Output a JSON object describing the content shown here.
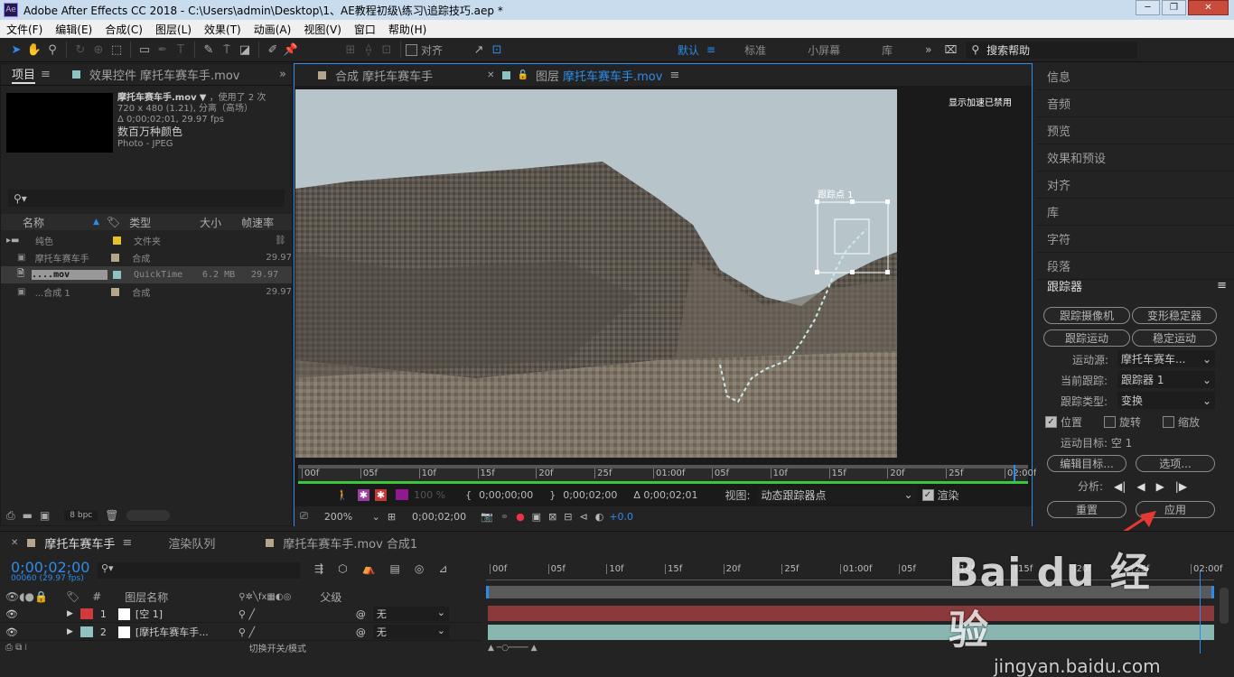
{
  "window": {
    "title": "Adobe After Effects CC 2018 - C:\\Users\\admin\\Desktop\\1、AE教程初级\\练习\\追踪技巧.aep *",
    "app_icon": "Ae"
  },
  "menu": [
    "文件(F)",
    "编辑(E)",
    "合成(C)",
    "图层(L)",
    "效果(T)",
    "动画(A)",
    "视图(V)",
    "窗口",
    "帮助(H)"
  ],
  "toolbar": {
    "align_label": "对齐",
    "workspaces": [
      "默认",
      "标准",
      "小屏幕",
      "库"
    ],
    "search_placeholder": "搜索帮助"
  },
  "project": {
    "tab_project": "项目",
    "tab_effects": "效果控件 摩托车赛车手.mov",
    "info_name": "摩托车赛车手.mov",
    "info_used": "，使用了 2 次",
    "info_dims": "720 x 480 (1.21), 分离（高场）",
    "info_duration": "Δ 0;00;02;01, 29.97 fps",
    "info_colors": "数百万种颜色",
    "info_codec": "Photo - JPEG",
    "columns": {
      "name": "名称",
      "type": "类型",
      "size": "大小",
      "fps": "帧速率"
    },
    "items": [
      {
        "name": "纯色",
        "type": "文件夹",
        "size": "",
        "fps": "",
        "color": "#e6c229"
      },
      {
        "name": "摩托车赛车手",
        "type": "合成",
        "size": "",
        "fps": "29.97",
        "color": "#b5a58a"
      },
      {
        "name": "....mov",
        "type": "QuickTime",
        "size": "6.2 MB",
        "fps": "29.97",
        "color": "#8fc3c3"
      },
      {
        "name": "...合成 1",
        "type": "合成",
        "size": "",
        "fps": "29.97",
        "color": "#b5a58a"
      }
    ],
    "bpc": "8 bpc"
  },
  "viewer": {
    "tab_comp": "合成 摩托车赛车手",
    "tab_layer_prefix": "图层",
    "tab_layer_name": "摩托车赛车手.mov",
    "gpu_notice": "显示加速已禁用",
    "track_point_label": "跟踪点 1",
    "ruler": [
      "00f",
      "05f",
      "10f",
      "15f",
      "20f",
      "25f",
      "01:00f",
      "05f",
      "10f",
      "15f",
      "20f",
      "25f",
      "02:00f"
    ],
    "opacity": "100 %",
    "in_time": "0;00;00;00",
    "out_time": "0;00;02;00",
    "duration": "Δ 0;00;02;01",
    "view_label": "视图:",
    "view_value": "动态跟踪器点",
    "render_label": "渲染",
    "zoom": "200%",
    "current_time": "0;00;02;00",
    "exposure": "+0.0"
  },
  "right_panels": [
    "信息",
    "音频",
    "预览",
    "效果和预设",
    "对齐",
    "库",
    "字符",
    "段落"
  ],
  "tracker": {
    "title": "跟踪器",
    "btn_track_camera": "跟踪摄像机",
    "btn_warp_stabilizer": "变形稳定器",
    "btn_track_motion": "跟踪运动",
    "btn_stabilize_motion": "稳定运动",
    "motion_source_label": "运动源:",
    "motion_source_value": "摩托车赛车...",
    "current_track_label": "当前跟踪:",
    "current_track_value": "跟踪器 1",
    "track_type_label": "跟踪类型:",
    "track_type_value": "变换",
    "position_label": "位置",
    "rotation_label": "旋转",
    "scale_label": "缩放",
    "motion_target": "运动目标: 空 1",
    "btn_edit_target": "编辑目标...",
    "btn_options": "选项...",
    "analyze_label": "分析:",
    "btn_reset": "重置",
    "btn_apply": "应用"
  },
  "timeline": {
    "tab_active": "摩托车赛车手",
    "tab_render": "渲染队列",
    "tab_other": "摩托车赛车手.mov 合成1",
    "timecode": "0;00;02;00",
    "frame_info": "00060 (29.97 fps)",
    "col_layer_name": "图层名称",
    "col_parent": "父级",
    "col_num": "#",
    "ruler": [
      "00f",
      "05f",
      "10f",
      "15f",
      "20f",
      "25f",
      "01:00f",
      "05f",
      "10f",
      "15f",
      "20f",
      "25f",
      "02:00f"
    ],
    "layers": [
      {
        "num": "1",
        "name": "[空 1]",
        "parent": "无",
        "label_color": "#d03a3a",
        "bar_color": "#8a3a3a"
      },
      {
        "num": "2",
        "name": "[摩托车赛车手...",
        "parent": "无",
        "label_color": "#8fc3c3",
        "bar_color": "#8ab6b2"
      }
    ],
    "toggle_label": "切换开关/模式"
  },
  "watermark": {
    "brand": "Bai du 经验",
    "url": "jingyan.baidu.com"
  }
}
